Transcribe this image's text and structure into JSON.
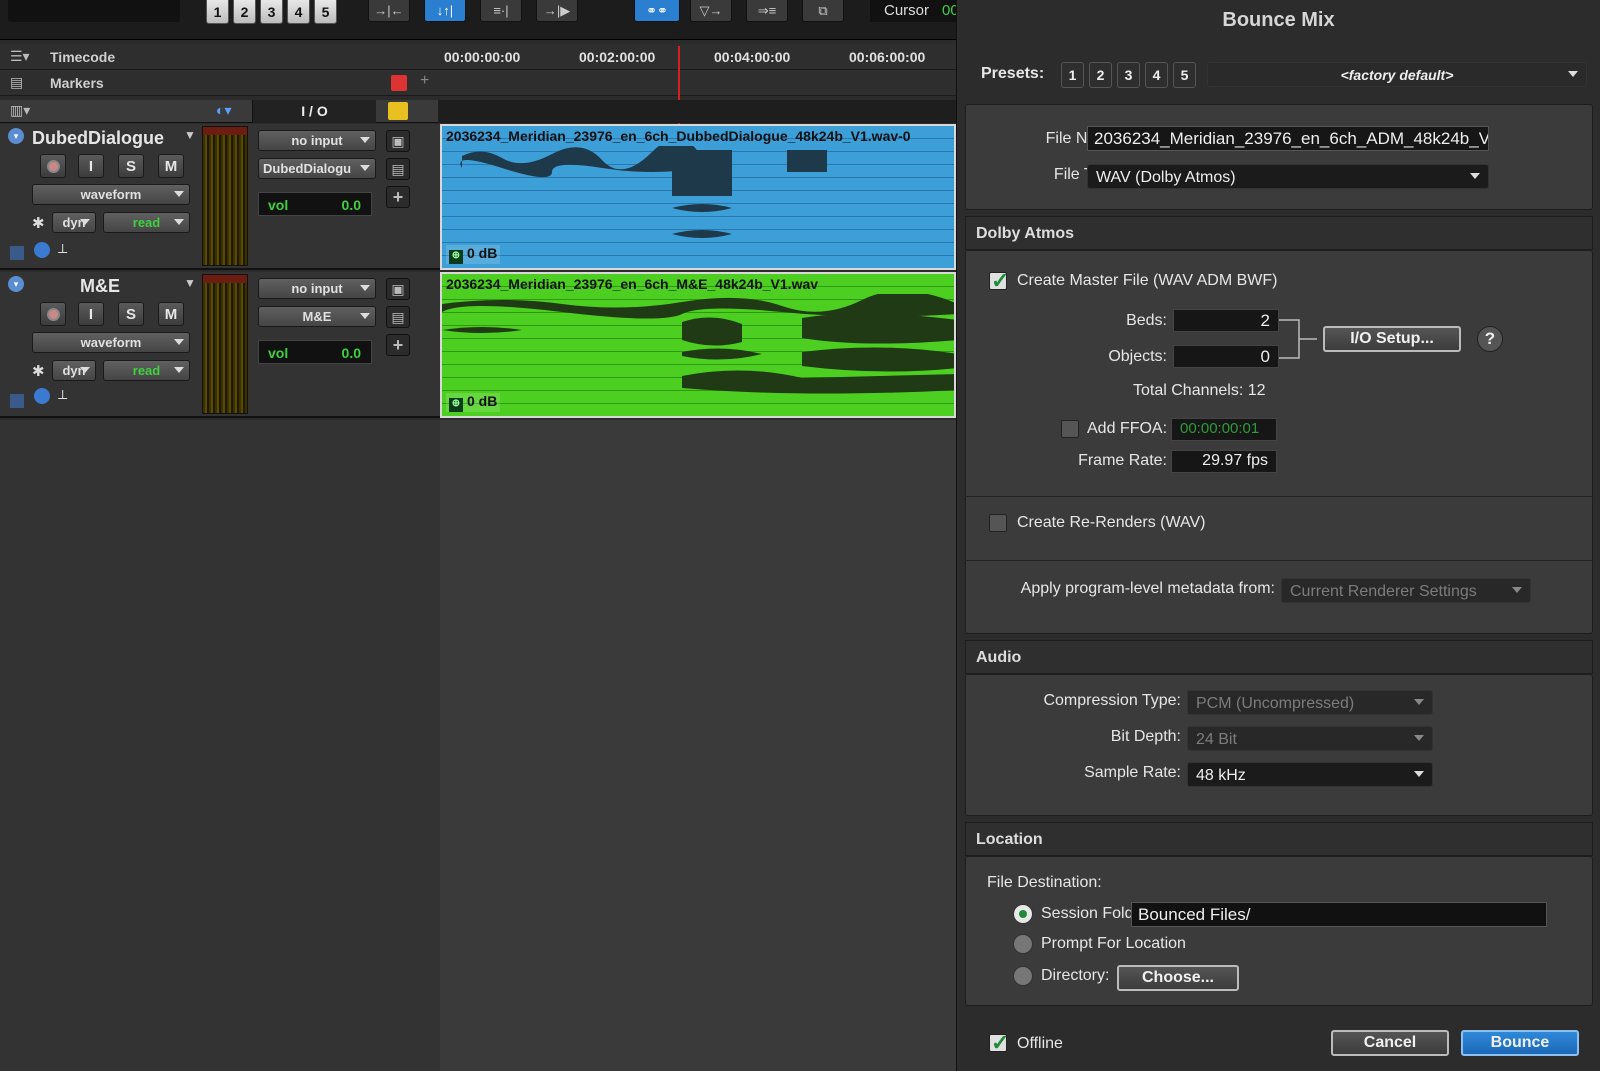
{
  "toolbar": {
    "preset_numbers": [
      "1",
      "2",
      "3",
      "4",
      "5"
    ],
    "cursor_label": "Cursor",
    "cursor_value": "00"
  },
  "rulers": {
    "timecode_label": "Timecode",
    "markers_label": "Markers",
    "ticks": [
      "00:00:00:00",
      "00:02:00:00",
      "00:04:00:00",
      "00:06:00:00"
    ]
  },
  "column_header": {
    "io_label": "I / O"
  },
  "tracks": [
    {
      "name": "DubedDialogue",
      "rec": "",
      "input": "I",
      "solo": "S",
      "mute": "M",
      "view": "waveform",
      "dyn": "dyn",
      "automation": "read",
      "input_sel": "no input",
      "output_sel": "DubedDialogu",
      "vol_label": "vol",
      "vol_value": "0.0",
      "clip_title": "2036234_Meridian_23976_en_6ch_DubbedDialogue_48k24b_V1.wav-0",
      "clip_gain": "0 dB",
      "clip_color": "#3d9fd8"
    },
    {
      "name": "M&E",
      "rec": "",
      "input": "I",
      "solo": "S",
      "mute": "M",
      "view": "waveform",
      "dyn": "dyn",
      "automation": "read",
      "input_sel": "no input",
      "output_sel": "M&E",
      "vol_label": "vol",
      "vol_value": "0.0",
      "clip_title": "2036234_Meridian_23976_en_6ch_M&E_48k24b_V1.wav",
      "clip_gain": "0 dB",
      "clip_color": "#4ccf20"
    }
  ],
  "dialog": {
    "title": "Bounce Mix",
    "presets_label": "Presets:",
    "preset_buttons": [
      "1",
      "2",
      "3",
      "4",
      "5"
    ],
    "preset_value": "<factory default>",
    "file_name_label": "File Name:",
    "file_name_value": "2036234_Meridian_23976_en_6ch_ADM_48k24b_V",
    "file_type_label": "File Type:",
    "file_type_value": "WAV (Dolby Atmos)",
    "dolby": {
      "header": "Dolby Atmos",
      "create_master_label": "Create Master File (WAV ADM BWF)",
      "create_master_checked": true,
      "beds_label": "Beds:",
      "beds_value": "2",
      "objects_label": "Objects:",
      "objects_value": "0",
      "io_setup_label": "I/O Setup...",
      "help_label": "?",
      "total_channels": "Total Channels: 12",
      "add_ffoa_label": "Add FFOA:",
      "add_ffoa_checked": false,
      "ffoa_value": "00:00:00:01",
      "frame_rate_label": "Frame Rate:",
      "frame_rate_value": "29.97 fps",
      "rerenders_label": "Create Re-Renders (WAV)",
      "rerenders_checked": false,
      "metadata_label": "Apply program-level metadata from:",
      "metadata_value": "Current Renderer Settings"
    },
    "audio": {
      "header": "Audio",
      "compression_label": "Compression Type:",
      "compression_value": "PCM (Uncompressed)",
      "bitdepth_label": "Bit Depth:",
      "bitdepth_value": "24 Bit",
      "samplerate_label": "Sample Rate:",
      "samplerate_value": "48 kHz"
    },
    "location": {
      "header": "Location",
      "dest_label": "File Destination:",
      "session_folder_label": "Session Folder:",
      "session_folder_value": "Bounced Files/",
      "prompt_label": "Prompt For Location",
      "directory_label": "Directory:",
      "choose_label": "Choose...",
      "selected": "session_folder"
    },
    "offline_label": "Offline",
    "offline_checked": true,
    "cancel_label": "Cancel",
    "bounce_label": "Bounce"
  }
}
